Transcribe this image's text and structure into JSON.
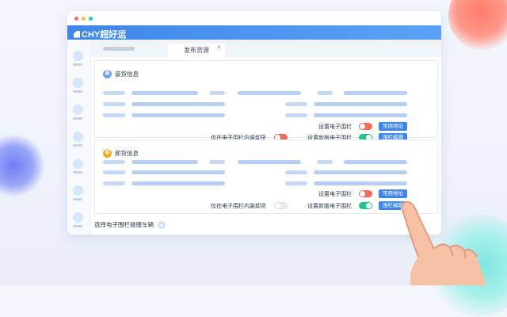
{
  "app": {
    "logo_text": "CHY超好运",
    "colors": {
      "brand": "#3f86ea",
      "dot_red": "#f36b6b",
      "dot_yellow": "#f5c04a",
      "dot_green": "#2bc7c0"
    }
  },
  "tabs": [
    {
      "label": "发布货源",
      "close": "×"
    }
  ],
  "sections": [
    {
      "badge": "装",
      "badge_color": "#6aa0ef",
      "title": "装货信息",
      "labels": {
        "set_fence": "设置电子围栏",
        "only_in_fence": "仅在电子围栏内装卸货",
        "new_fence": "设置新版电子围栏"
      },
      "buttons": {
        "common_address": "常用地址",
        "fence_edit": "围栏编辑"
      },
      "toggles": {
        "set_fence": "on-red",
        "only_in_fence": "on-red",
        "new_fence": "on-green"
      }
    },
    {
      "badge": "卸",
      "badge_color": "#f5a623",
      "title": "卸货信息",
      "labels": {
        "set_fence": "设置电子围栏",
        "only_in_fence": "仅在电子围栏内装卸货",
        "new_fence": "设置新版电子围栏"
      },
      "buttons": {
        "common_address": "常用地址",
        "fence_edit": "围栏编辑"
      },
      "toggles": {
        "set_fence": "off",
        "only_in_fence": "on-red",
        "new_fence": "on-green"
      }
    }
  ],
  "vehicle": {
    "label": "选择电子围栏碰撞车辆",
    "add_icon": "plus-icon"
  }
}
